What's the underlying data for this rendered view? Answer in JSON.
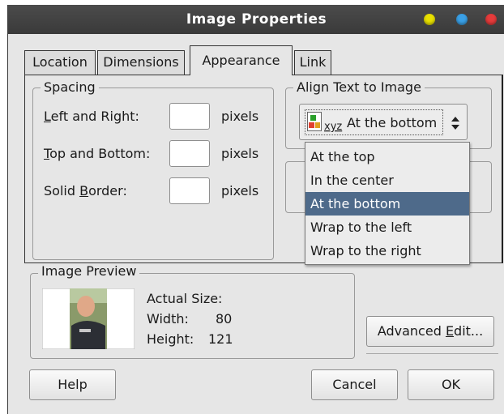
{
  "window": {
    "title": "Image Properties"
  },
  "tabs": [
    {
      "label": "Location"
    },
    {
      "label": "Dimensions"
    },
    {
      "label": "Appearance"
    },
    {
      "label": "Link"
    }
  ],
  "spacing": {
    "legend": "Spacing",
    "left_right": {
      "pre": "",
      "mnemonic": "L",
      "post": "eft and Right:",
      "unit": "pixels",
      "value": ""
    },
    "top_bottom": {
      "pre": "",
      "mnemonic": "T",
      "post": "op and Bottom:",
      "unit": "pixels",
      "value": ""
    },
    "border": {
      "pre": "Solid ",
      "mnemonic": "B",
      "post": "order:",
      "unit": "pixels",
      "value": ""
    }
  },
  "align": {
    "legend": "Align Text to Image",
    "selected": "At the bottom",
    "icon_text": "xyz",
    "options": [
      "At the top",
      "In the center",
      "At the bottom",
      "Wrap to the left",
      "Wrap to the right"
    ]
  },
  "preview": {
    "legend": "Image Preview",
    "actual_size": "Actual Size:",
    "width_label": "Width:",
    "width_value": "80",
    "height_label": "Height:",
    "height_value": "121"
  },
  "buttons": {
    "advanced_pre": "Advanced ",
    "advanced_mnemonic": "E",
    "advanced_post": "dit...",
    "help": "Help",
    "cancel": "Cancel",
    "ok": "OK"
  }
}
